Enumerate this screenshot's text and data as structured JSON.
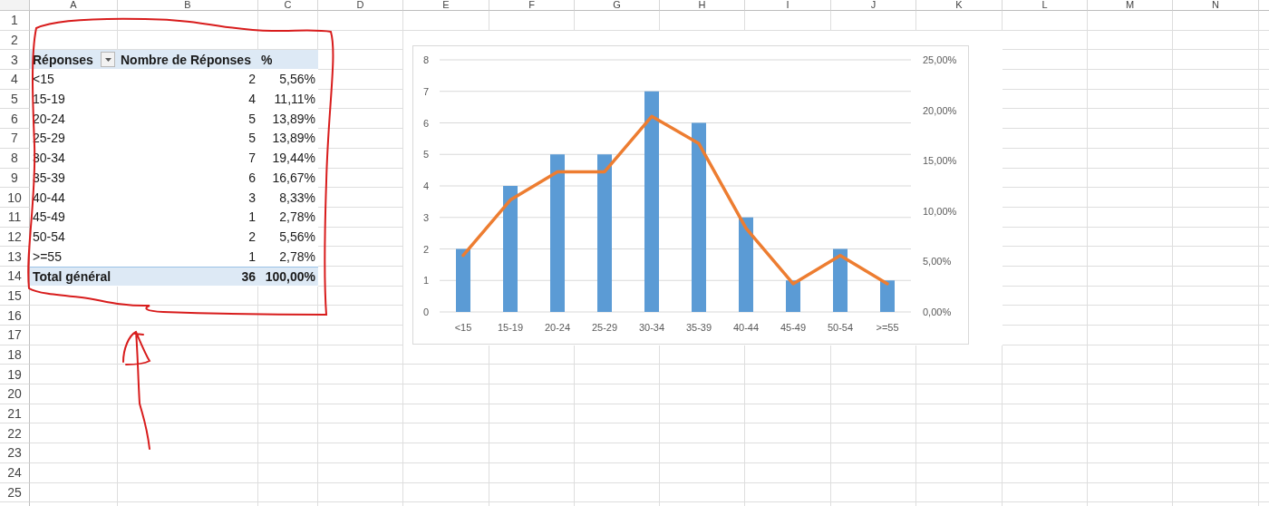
{
  "sheet": {
    "columns": [
      "A",
      "B",
      "C",
      "D",
      "E",
      "F",
      "G",
      "H",
      "I",
      "J",
      "K",
      "L",
      "M",
      "N"
    ],
    "rows": [
      "1",
      "2",
      "3",
      "4",
      "5",
      "6",
      "7",
      "8",
      "9",
      "10",
      "11",
      "12",
      "13",
      "14",
      "15",
      "16",
      "17",
      "18",
      "19",
      "20",
      "21",
      "22",
      "23",
      "24",
      "25"
    ]
  },
  "pivot_table": {
    "headers": [
      "Réponses",
      "Nombre de Réponses",
      "%"
    ],
    "rows": [
      {
        "label": "<15",
        "count": "2",
        "percent": "5,56%"
      },
      {
        "label": "15-19",
        "count": "4",
        "percent": "11,11%"
      },
      {
        "label": "20-24",
        "count": "5",
        "percent": "13,89%"
      },
      {
        "label": "25-29",
        "count": "5",
        "percent": "13,89%"
      },
      {
        "label": "30-34",
        "count": "7",
        "percent": "19,44%"
      },
      {
        "label": "35-39",
        "count": "6",
        "percent": "16,67%"
      },
      {
        "label": "40-44",
        "count": "3",
        "percent": "8,33%"
      },
      {
        "label": "45-49",
        "count": "1",
        "percent": "2,78%"
      },
      {
        "label": "50-54",
        "count": "2",
        "percent": "5,56%"
      },
      {
        "label": ">=55",
        "count": "1",
        "percent": "2,78%"
      }
    ],
    "total": {
      "label": "Total général",
      "count": "36",
      "percent": "100,00%"
    }
  },
  "chart": {
    "chart_data": {
      "type": "bar",
      "categories": [
        "<15",
        "15-19",
        "20-24",
        "25-29",
        "30-34",
        "35-39",
        "40-44",
        "45-49",
        "50-54",
        ">=55"
      ],
      "series": [
        {
          "type": "bar",
          "color": "#5b9bd5",
          "values": [
            2,
            4,
            5,
            5,
            7,
            6,
            3,
            1,
            2,
            1
          ]
        },
        {
          "type": "line",
          "axis": "y2",
          "color": "#ed7d31",
          "values": [
            0.056,
            0.111,
            0.139,
            0.139,
            0.194,
            0.167,
            0.083,
            0.028,
            0.056,
            0.028
          ]
        }
      ],
      "grid": true,
      "ylim": [
        0,
        8
      ],
      "yticks": [
        0,
        1,
        2,
        3,
        4,
        5,
        6,
        7,
        8
      ],
      "y2lim": [
        0,
        0.25
      ],
      "y2ticks": [
        {
          "value": 0,
          "label": "0,00%"
        },
        {
          "value": 0.05,
          "label": "5,00%"
        },
        {
          "value": 0.1,
          "label": "10,00%"
        },
        {
          "value": 0.15,
          "label": "15,00%"
        },
        {
          "value": 0.2,
          "label": "20,00%"
        },
        {
          "value": 0.25,
          "label": "25,00%"
        }
      ]
    }
  }
}
